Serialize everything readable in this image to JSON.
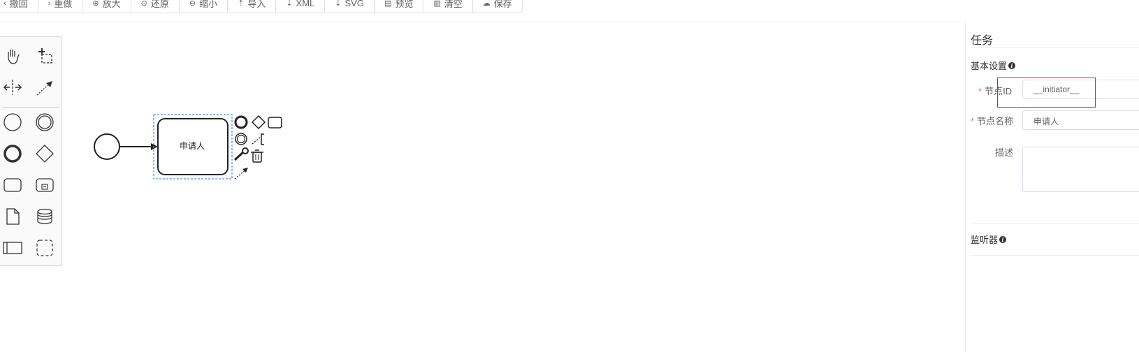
{
  "toolbar": {
    "buttons": [
      {
        "icon": "chevron-left-icon",
        "glyph": "‹",
        "label": "撤回"
      },
      {
        "icon": "chevron-right-icon",
        "glyph": "›",
        "label": "重做"
      },
      {
        "icon": "zoom-in-icon",
        "glyph": "⊕",
        "label": "放大"
      },
      {
        "icon": "reset-icon",
        "glyph": "⊙",
        "label": "还原"
      },
      {
        "icon": "zoom-out-icon",
        "glyph": "⊖",
        "label": "缩小"
      },
      {
        "icon": "upload-icon",
        "glyph": "⇡",
        "label": "导入"
      },
      {
        "icon": "download-icon",
        "glyph": "⇣",
        "label": "XML"
      },
      {
        "icon": "download-icon",
        "glyph": "⇣",
        "label": "SVG"
      },
      {
        "icon": "document-icon",
        "glyph": "▤",
        "label": "预览"
      },
      {
        "icon": "trash-icon",
        "glyph": "▥",
        "label": "清空"
      },
      {
        "icon": "cloud-upload-icon",
        "glyph": "☁",
        "label": "保存"
      }
    ]
  },
  "diagram": {
    "task_label": "申请人"
  },
  "panel": {
    "title": "任务",
    "basic_section": "基本设置",
    "fields": {
      "id_label": "节点ID",
      "id_value": "__initiator__",
      "name_label": "节点名称",
      "name_value": "申请人",
      "desc_label": "描述",
      "desc_value": ""
    },
    "listener_section": "监听器",
    "required_mark": "*"
  },
  "colors": {
    "highlight_box": "#e02020",
    "required": "#f56c6c",
    "selection": "#4a90d9"
  }
}
